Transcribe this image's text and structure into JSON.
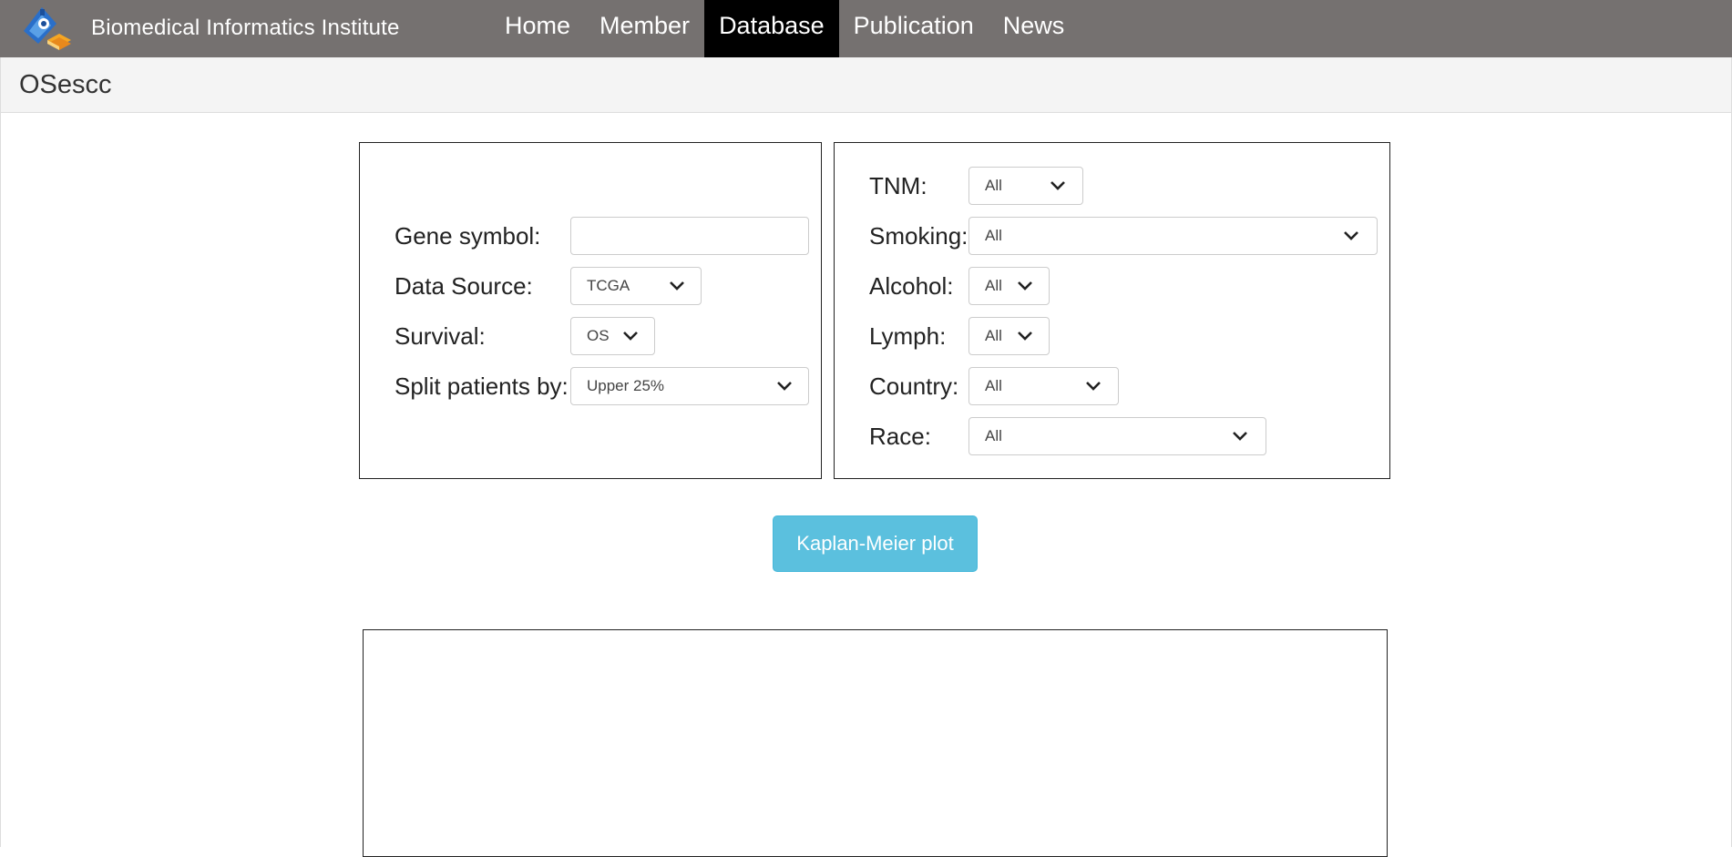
{
  "navbar": {
    "brand_title": "Biomedical Informatics Institute",
    "items": [
      {
        "label": "Home",
        "active": false
      },
      {
        "label": "Member",
        "active": false
      },
      {
        "label": "Database",
        "active": true
      },
      {
        "label": "Publication",
        "active": false
      },
      {
        "label": "News",
        "active": false
      }
    ]
  },
  "page": {
    "title": "OSescc"
  },
  "left_form": {
    "gene_symbol": {
      "label": "Gene symbol:",
      "value": ""
    },
    "data_source": {
      "label": "Data Source:",
      "value": "TCGA"
    },
    "survival": {
      "label": "Survival:",
      "value": "OS"
    },
    "split": {
      "label": "Split patients by:",
      "value": "Upper 25%"
    }
  },
  "right_form": {
    "tnm": {
      "label": "TNM:",
      "value": "All"
    },
    "smoking": {
      "label": "Smoking:",
      "value": "All"
    },
    "alcohol": {
      "label": "Alcohol:",
      "value": "All"
    },
    "lymph": {
      "label": "Lymph:",
      "value": "All"
    },
    "country": {
      "label": "Country:",
      "value": "All"
    },
    "race": {
      "label": "Race:",
      "value": "All"
    }
  },
  "actions": {
    "km_button_label": "Kaplan-Meier plot"
  },
  "colors": {
    "navbar_bg": "#757170",
    "nav_active_bg": "#000000",
    "button_bg": "#5bc0de",
    "title_bar_bg": "#f4f4f4"
  }
}
